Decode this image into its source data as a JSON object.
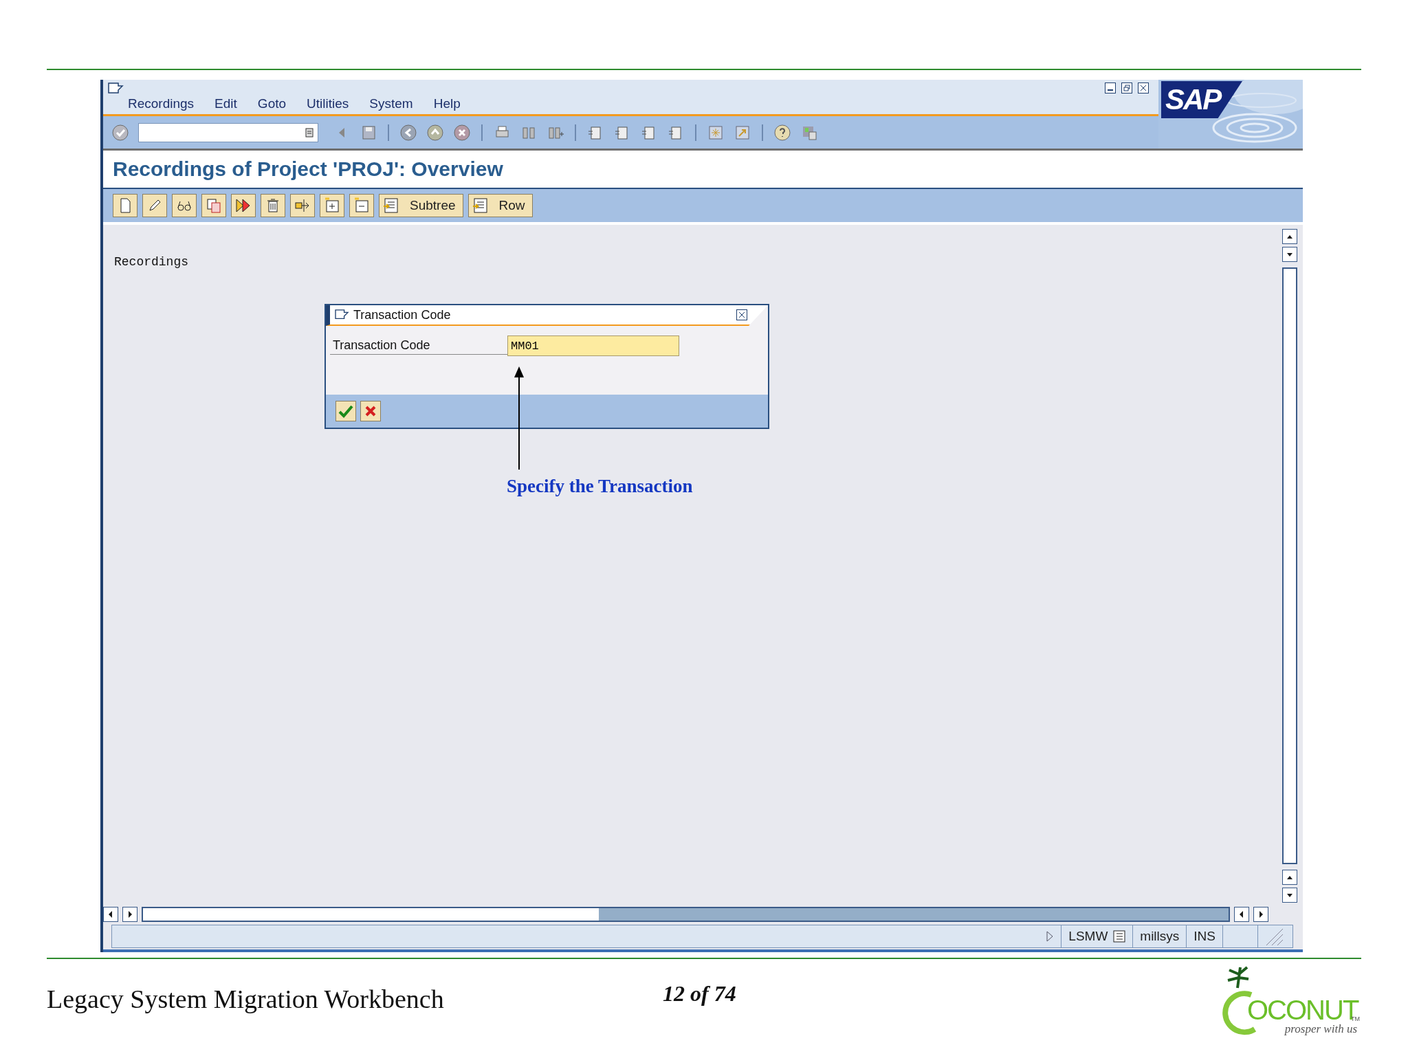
{
  "window": {
    "menu": [
      {
        "label": "Recordings"
      },
      {
        "label": "Edit"
      },
      {
        "label": "Goto"
      },
      {
        "label": "Utilities"
      },
      {
        "label": "System"
      },
      {
        "label": "Help"
      }
    ],
    "logo": "SAP"
  },
  "screen_title": "Recordings of Project 'PROJ': Overview",
  "app_toolbar": {
    "buttons": [
      {
        "label": "Subtree"
      },
      {
        "label": "Row"
      }
    ]
  },
  "content": {
    "heading": "Recordings"
  },
  "dialog": {
    "title": "Transaction Code",
    "field": {
      "label": "Transaction Code",
      "value": "MM01"
    }
  },
  "annotation": "Specify the Transaction",
  "status_bar": {
    "fields": [
      "LSMW",
      "millsys",
      "INS"
    ]
  },
  "slide_footer": {
    "title": "Legacy System Migration Workbench",
    "page": "12 of 74",
    "logo": {
      "wordmark": "OCONUT",
      "mark": "TM",
      "tagline": "prosper with us"
    }
  }
}
